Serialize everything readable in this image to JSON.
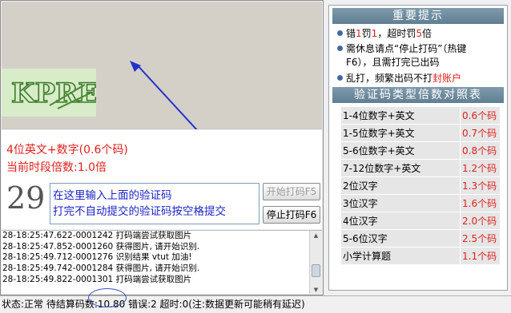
{
  "left": {
    "captcha_image_text": "KPRE",
    "captcha_type_line": "4位英文+数字(0.6个码)",
    "multiplier_line": "当前时段倍数:1.0倍",
    "countdown": "29",
    "input_hint_line1": "在这里输入上面的验证码",
    "input_hint_line2": "打完不自动提交的验证码按空格提交",
    "start_button": "开始打码F5",
    "stop_button": "停止打码F6"
  },
  "log": [
    "28-18:25:47.622-0001242 打码端尝试获取图片",
    "28-18:25:47.852-0001260 获得图片, 请开始识别.",
    "28-18:25:49.712-0001276 识别结果 vtut 加油!",
    "28-18:25:49.742-0001284 获得图片, 请开始识别.",
    "28-18:25:49.822-0001301 打码端尝试获取图片"
  ],
  "notice": {
    "title": "重要提示",
    "item1": {
      "a": "错",
      "b": "1",
      "c": "罚",
      "d": "1",
      "e": "，超时罚",
      "f": "5",
      "g": "倍"
    },
    "item2_line1": "需休息请点“停止打码”（热键",
    "item2_line2": "F6），且需打完已出码",
    "item3": {
      "a": "乱打，频繁出码不打",
      "b": "封账户"
    }
  },
  "rate_table": {
    "title": "验证码类型倍数对照表",
    "rows": [
      {
        "type": "1-4位数字+英文",
        "rate": "0.6个码"
      },
      {
        "type": "1-5位数字+英文",
        "rate": "0.7个码"
      },
      {
        "type": "5-6位数字+英文",
        "rate": "0.8个码"
      },
      {
        "type": "7-12位数字+英文",
        "rate": "1.2个码"
      },
      {
        "type": "2位汉字",
        "rate": "1.3个码"
      },
      {
        "type": "3位汉字",
        "rate": "1.6个码"
      },
      {
        "type": "4位汉字",
        "rate": "2.0个码"
      },
      {
        "type": "5-6位汉字",
        "rate": "2.5个码"
      },
      {
        "type": "小学计算题",
        "rate": "1.1个码"
      }
    ]
  },
  "status": "状态:正常 待结算码数:10.80 错误:2 超时:0(注:数据更新可能稍有延迟)",
  "colors": {
    "red": "#e0201c",
    "hint_blue": "#1c24c8",
    "header_bg": "#607f93"
  }
}
